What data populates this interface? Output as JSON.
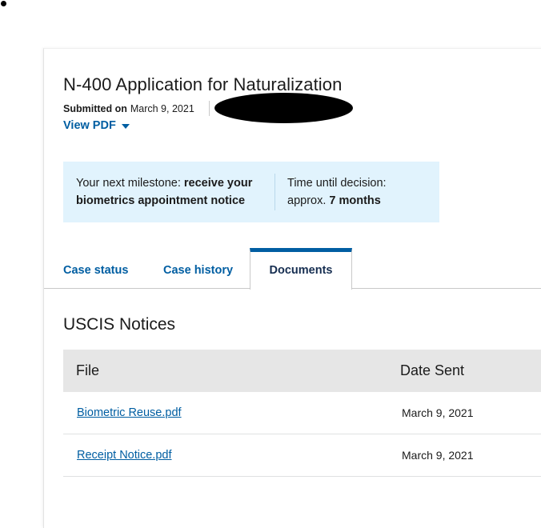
{
  "application": {
    "title": "N-400 Application for Naturalization",
    "submitted_label": "Submitted on",
    "submitted_date": "March 9, 2021",
    "view_pdf_label": "View PDF"
  },
  "milestone": {
    "prefix": "Your next milestone:",
    "value": "receive your biometrics appointment notice",
    "time_label": "Time until decision:",
    "time_prefix": "approx.",
    "time_value": "7 months"
  },
  "tabs": [
    {
      "label": "Case status",
      "active": false
    },
    {
      "label": "Case history",
      "active": false
    },
    {
      "label": "Documents",
      "active": true
    }
  ],
  "notices": {
    "title": "USCIS Notices",
    "columns": [
      "File",
      "Date Sent"
    ],
    "rows": [
      {
        "file": "Biometric Reuse.pdf",
        "date": "March 9, 2021"
      },
      {
        "file": "Receipt Notice.pdf",
        "date": "March 9, 2021"
      }
    ]
  },
  "colors": {
    "link": "#005ea2",
    "milestone_bg": "#e1f3fd",
    "table_header_bg": "#e6e6e6"
  }
}
